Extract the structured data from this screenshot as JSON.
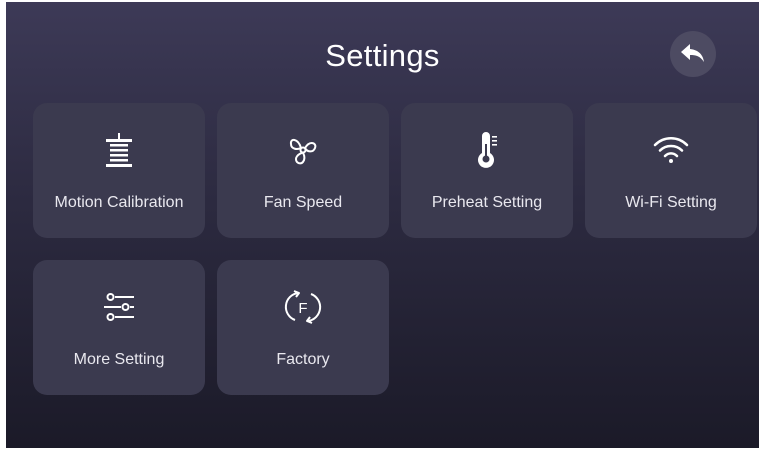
{
  "header": {
    "title": "Settings",
    "back_icon": "undo-arrow-icon"
  },
  "tiles": [
    {
      "label": "Motion Calibration",
      "icon": "printer-bed-level-icon"
    },
    {
      "label": "Fan Speed",
      "icon": "fan-icon"
    },
    {
      "label": "Preheat Setting",
      "icon": "thermometer-icon"
    },
    {
      "label": "Wi-Fi Setting",
      "icon": "wifi-icon"
    },
    {
      "label": "More Setting",
      "icon": "sliders-icon"
    },
    {
      "label": "Factory",
      "icon": "factory-reset-icon"
    }
  ],
  "colors": {
    "background_top": "#3d3a57",
    "background_bottom": "#1b1a28",
    "tile": "#3b3a4f",
    "text": "#ffffff"
  }
}
